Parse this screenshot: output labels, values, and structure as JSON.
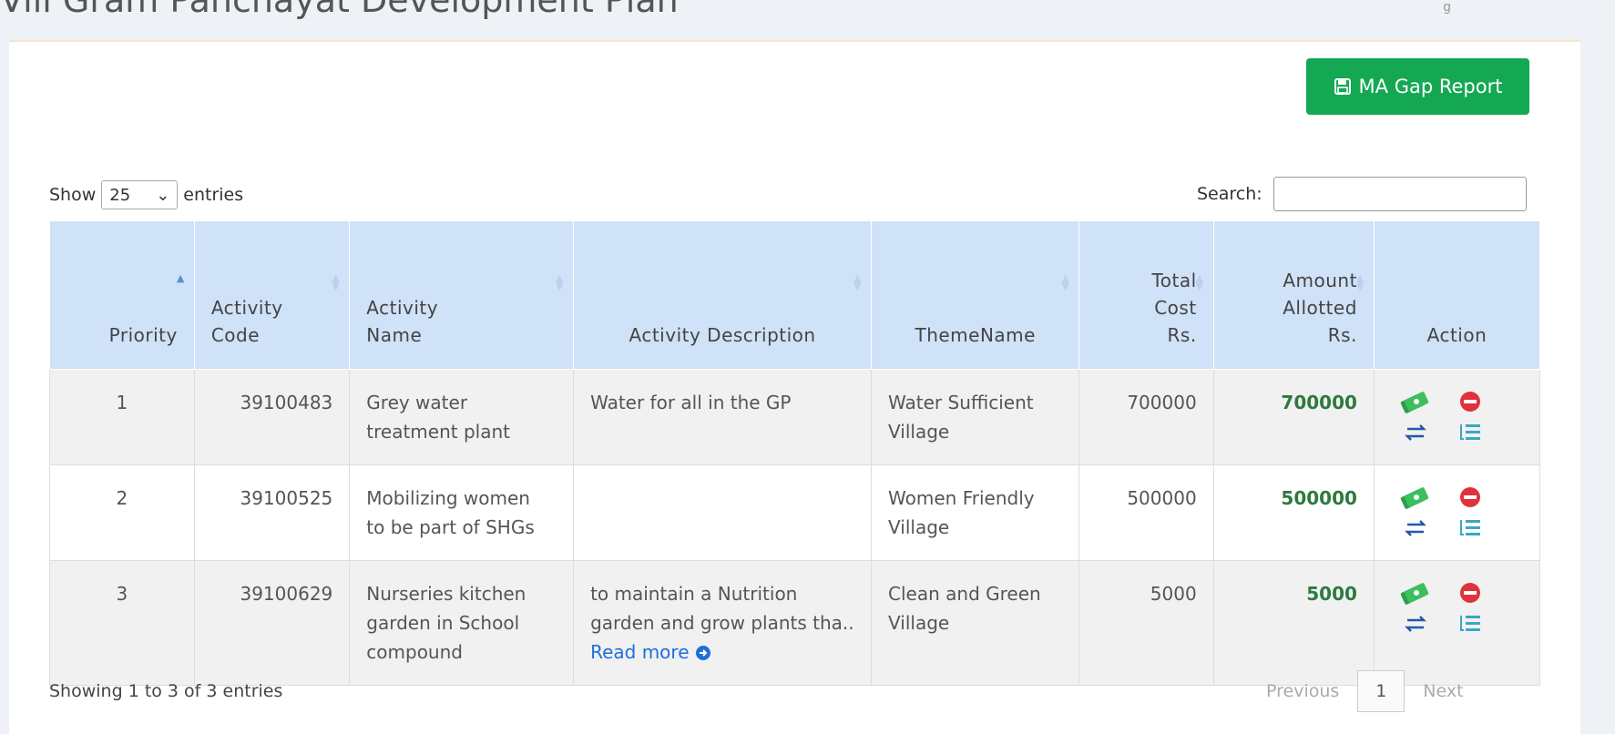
{
  "header": {
    "title": "Vill Gram Panchayat Development Plan",
    "right_hint": "g"
  },
  "toolbar": {
    "gap_report_label": "MA Gap Report"
  },
  "length": {
    "show_label": "Show",
    "selected": "25",
    "entries_label": "entries"
  },
  "search": {
    "label": "Search:",
    "value": ""
  },
  "table": {
    "headers": {
      "priority": "Priority",
      "activity_code": [
        "Activity",
        "Code"
      ],
      "activity_name": [
        "Activity",
        "Name"
      ],
      "activity_description": "Activity Description",
      "theme_name": "ThemeName",
      "total_cost": [
        "Total",
        "Cost",
        "Rs."
      ],
      "amount_allotted": [
        "Amount",
        "Allotted",
        "Rs."
      ],
      "action": "Action"
    },
    "rows": [
      {
        "priority": "1",
        "code": "39100483",
        "name": [
          "Grey water",
          "treatment plant"
        ],
        "description": "Water for all in the GP",
        "read_more": "",
        "theme": [
          "Water Sufficient",
          "Village"
        ],
        "total": "700000",
        "allotted": "700000"
      },
      {
        "priority": "2",
        "code": "39100525",
        "name": [
          "Mobilizing women",
          "to be part of SHGs"
        ],
        "description": "",
        "read_more": "",
        "theme": [
          "Women Friendly",
          "Village"
        ],
        "total": "500000",
        "allotted": "500000"
      },
      {
        "priority": "3",
        "code": "39100629",
        "name": [
          "Nurseries kitchen",
          "garden in School",
          "compound"
        ],
        "description": "to maintain a Nutrition garden and grow plants tha..",
        "read_more": "Read more",
        "theme": [
          "Clean and Green",
          "Village"
        ],
        "total": "5000",
        "allotted": "5000"
      }
    ]
  },
  "footer": {
    "info": "Showing 1 to 3 of 3 entries",
    "previous": "Previous",
    "current_page": "1",
    "next": "Next"
  },
  "colors": {
    "primary_green": "#14a853",
    "header_blue": "#cfe2f7",
    "allotted_green": "#2d7a3e",
    "delete_red": "#e0323c",
    "link_blue": "#1d6fd8"
  },
  "icons": [
    "save-icon",
    "money-icon",
    "delete-icon",
    "transfer-icon",
    "list-icon",
    "arrow-circle-right-icon"
  ]
}
